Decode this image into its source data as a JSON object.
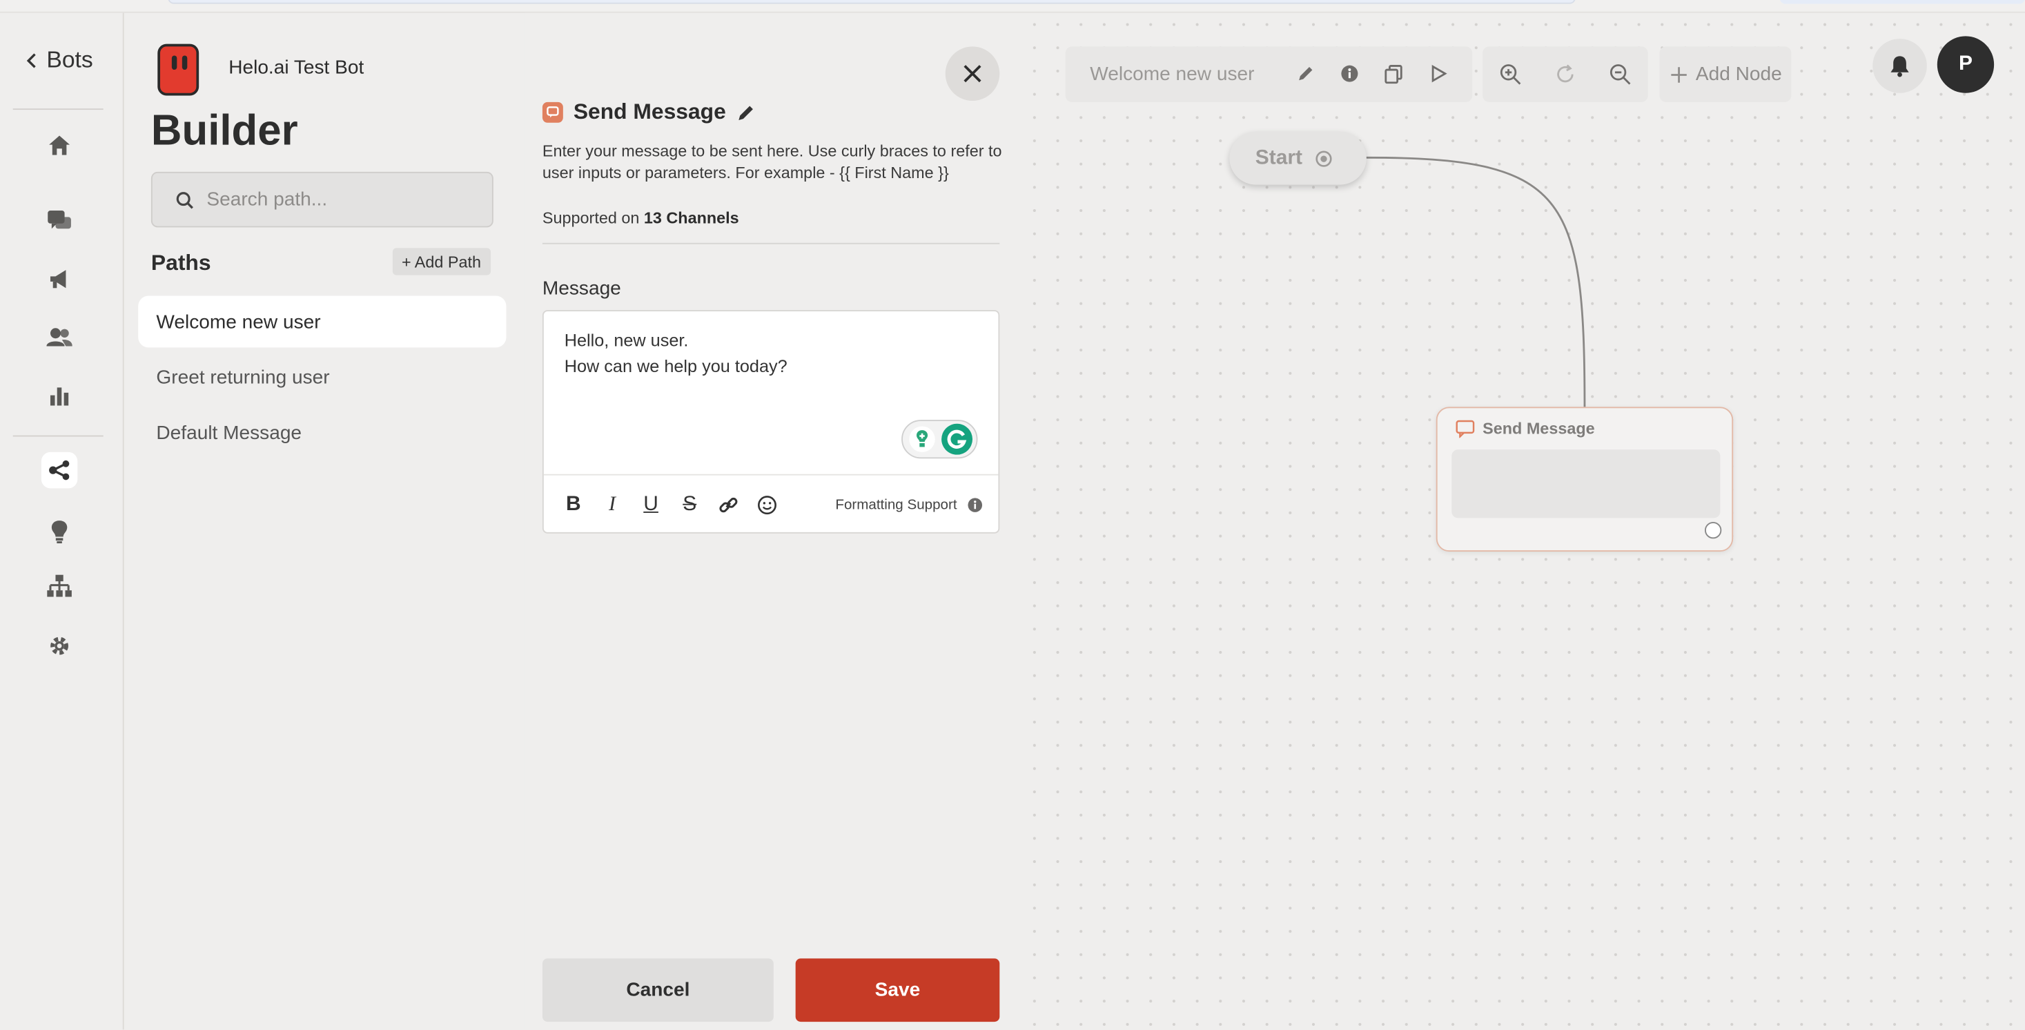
{
  "rail": {
    "back_label": "Bots",
    "items": [
      {
        "name": "home-icon"
      },
      {
        "name": "conversations-icon"
      },
      {
        "name": "broadcast-icon"
      },
      {
        "name": "users-icon"
      },
      {
        "name": "analytics-icon"
      },
      {
        "name": "builder-icon",
        "active": true
      },
      {
        "name": "ideas-icon"
      },
      {
        "name": "hierarchy-icon"
      },
      {
        "name": "settings-icon"
      }
    ]
  },
  "paths_panel": {
    "bot_name": "Helo.ai Test Bot",
    "title": "Builder",
    "search_placeholder": "Search path...",
    "paths_heading": "Paths",
    "add_path_label": "+ Add Path",
    "items": [
      {
        "label": "Welcome new user",
        "selected": true
      },
      {
        "label": "Greet returning user",
        "selected": false
      },
      {
        "label": "Default Message",
        "selected": false
      }
    ]
  },
  "editor": {
    "title": "Send Message",
    "description": "Enter your message to be sent here. Use curly braces to refer to user inputs or parameters. For example - {{ First Name }}",
    "supported_prefix": "Supported on",
    "supported_channels": "13 Channels",
    "message_label": "Message",
    "message_lines": [
      "Hello, new user.",
      "How can we help you today?"
    ],
    "formatting_support_label": "Formatting Support",
    "cancel_label": "Cancel",
    "save_label": "Save",
    "accent_color": "#c63b26"
  },
  "canvas": {
    "path_name": "Welcome new user",
    "add_node_label": "Add Node",
    "avatar_initial": "P",
    "start_label": "Start",
    "node_title": "Send Message"
  }
}
